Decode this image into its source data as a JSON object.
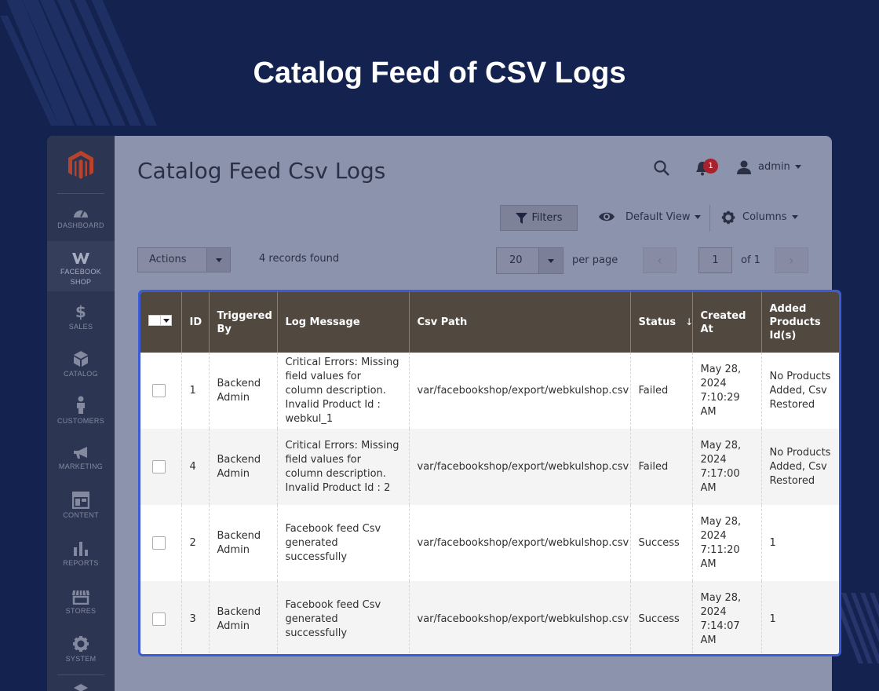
{
  "hero_title": "Catalog Feed of CSV Logs",
  "sidebar": {
    "items": [
      {
        "label": "DASHBOARD",
        "icon": "dashboard-icon"
      },
      {
        "label": "FACEBOOK\nSHOP",
        "icon": "facebook-shop-icon"
      },
      {
        "label": "SALES",
        "icon": "dollar-icon"
      },
      {
        "label": "CATALOG",
        "icon": "box-icon"
      },
      {
        "label": "CUSTOMERS",
        "icon": "person-icon"
      },
      {
        "label": "MARKETING",
        "icon": "megaphone-icon"
      },
      {
        "label": "CONTENT",
        "icon": "layout-icon"
      },
      {
        "label": "REPORTS",
        "icon": "bar-chart-icon"
      },
      {
        "label": "STORES",
        "icon": "storefront-icon"
      },
      {
        "label": "SYSTEM",
        "icon": "gear-icon"
      }
    ]
  },
  "header": {
    "page_title": "Catalog Feed Csv Logs",
    "notification_count": "1",
    "user": "admin"
  },
  "toolbar": {
    "filters_label": "Filters",
    "view_label": "Default View",
    "columns_label": "Columns",
    "actions_label": "Actions",
    "records_found": "4 records found",
    "per_page_value": "20",
    "per_page_label": "per page",
    "page_value": "1",
    "page_of": "of 1"
  },
  "table": {
    "columns": [
      "ID",
      "Triggered By",
      "Log Message",
      "Csv Path",
      "Status",
      "Created At",
      "Added Products Id(s)"
    ],
    "sort_indicator": "↓",
    "rows": [
      {
        "id": "1",
        "triggered_by": "Backend Admin",
        "message": "Critical Errors: Missing field values for column description. Invalid Product Id : webkul_1",
        "path": "var/facebookshop/export/webkulshop.csv",
        "status": "Failed",
        "created": "May 28, 2024 7:10:29 AM",
        "products": "No Products Added, Csv Restored"
      },
      {
        "id": "4",
        "triggered_by": "Backend Admin",
        "message": "Critical Errors: Missing field values for column description. Invalid Product Id : 2",
        "path": "var/facebookshop/export/webkulshop.csv",
        "status": "Failed",
        "created": "May 28, 2024 7:17:00 AM",
        "products": "No Products Added, Csv Restored"
      },
      {
        "id": "2",
        "triggered_by": "Backend Admin",
        "message": "Facebook feed Csv generated successfully",
        "path": "var/facebookshop/export/webkulshop.csv",
        "status": "Success",
        "created": "May 28, 2024 7:11:20 AM",
        "products": "1"
      },
      {
        "id": "3",
        "triggered_by": "Backend Admin",
        "message": "Facebook feed Csv generated successfully",
        "path": "var/facebookshop/export/webkulshop.csv",
        "status": "Success",
        "created": "May 28, 2024 7:14:07 AM",
        "products": "1"
      }
    ]
  },
  "colors": {
    "background": "#13224f",
    "sidebar": "#2c3551",
    "table_header": "#514840",
    "highlight_border": "#3a5ad8",
    "logo": "#b8432c"
  }
}
